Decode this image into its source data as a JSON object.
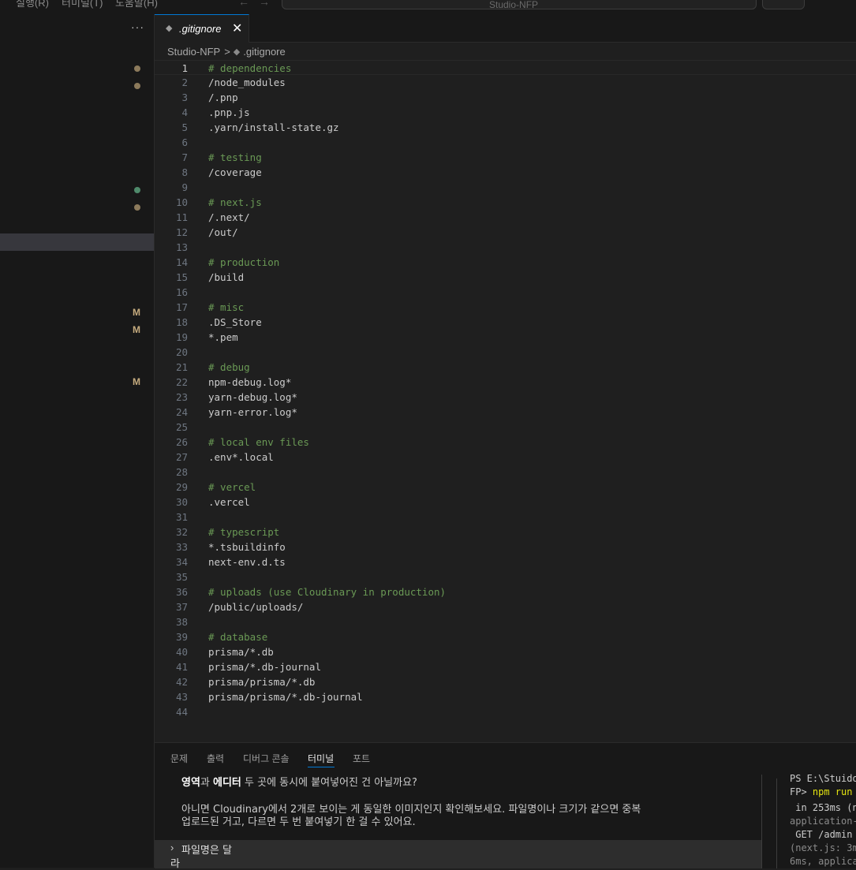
{
  "menubar": {
    "items": [
      "실행(R)",
      "터미널(T)",
      "도움말(H)"
    ],
    "back_arrow": "←",
    "forward_arrow": "→",
    "search_text": "Studio-NFP"
  },
  "sidebar": {
    "more_label": "···",
    "markers": [
      "M",
      "M",
      "M"
    ],
    "dot_colors": [
      "#8c7a5b",
      "#8c7a5b",
      "#4f8a6b",
      "#8c7a5b"
    ]
  },
  "tab": {
    "icon": "◆",
    "label": ".gitignore",
    "close": "✕"
  },
  "breadcrumb": {
    "folder": "Studio-NFP",
    "separator": ">",
    "icon": "◆",
    "file": ".gitignore"
  },
  "editor": {
    "active_line": 1,
    "lines": [
      {
        "n": "1",
        "text": "# dependencies"
      },
      {
        "n": "2",
        "text": "/node_modules"
      },
      {
        "n": "3",
        "text": "/.pnp"
      },
      {
        "n": "4",
        "text": ".pnp.js"
      },
      {
        "n": "5",
        "text": ".yarn/install-state.gz"
      },
      {
        "n": "6",
        "text": ""
      },
      {
        "n": "7",
        "text": "# testing"
      },
      {
        "n": "8",
        "text": "/coverage"
      },
      {
        "n": "9",
        "text": ""
      },
      {
        "n": "10",
        "text": "# next.js"
      },
      {
        "n": "11",
        "text": "/.next/"
      },
      {
        "n": "12",
        "text": "/out/"
      },
      {
        "n": "13",
        "text": ""
      },
      {
        "n": "14",
        "text": "# production"
      },
      {
        "n": "15",
        "text": "/build"
      },
      {
        "n": "16",
        "text": ""
      },
      {
        "n": "17",
        "text": "# misc"
      },
      {
        "n": "18",
        "text": ".DS_Store"
      },
      {
        "n": "19",
        "text": "*.pem"
      },
      {
        "n": "20",
        "text": ""
      },
      {
        "n": "21",
        "text": "# debug"
      },
      {
        "n": "22",
        "text": "npm-debug.log*"
      },
      {
        "n": "23",
        "text": "yarn-debug.log*"
      },
      {
        "n": "24",
        "text": "yarn-error.log*"
      },
      {
        "n": "25",
        "text": ""
      },
      {
        "n": "26",
        "text": "# local env files"
      },
      {
        "n": "27",
        "text": ".env*.local"
      },
      {
        "n": "28",
        "text": ""
      },
      {
        "n": "29",
        "text": "# vercel"
      },
      {
        "n": "30",
        "text": ".vercel"
      },
      {
        "n": "31",
        "text": ""
      },
      {
        "n": "32",
        "text": "# typescript"
      },
      {
        "n": "33",
        "text": "*.tsbuildinfo"
      },
      {
        "n": "34",
        "text": "next-env.d.ts"
      },
      {
        "n": "35",
        "text": ""
      },
      {
        "n": "36",
        "text": "# uploads (use Cloudinary in production)"
      },
      {
        "n": "37",
        "text": "/public/uploads/"
      },
      {
        "n": "38",
        "text": ""
      },
      {
        "n": "39",
        "text": "# database"
      },
      {
        "n": "40",
        "text": "prisma/*.db"
      },
      {
        "n": "41",
        "text": "prisma/*.db-journal"
      },
      {
        "n": "42",
        "text": "prisma/prisma/*.db"
      },
      {
        "n": "43",
        "text": "prisma/prisma/*.db-journal"
      },
      {
        "n": "44",
        "text": ""
      }
    ],
    "comment_color": "#6a9955"
  },
  "panel": {
    "tabs": [
      "문제",
      "출력",
      "디버그 콘솔",
      "터미널",
      "포트"
    ],
    "active_tab": "터미널",
    "chat": {
      "line1_a": "영역",
      "line1_b": "과 ",
      "line1_c": "에디터",
      "line1_d": " 두 곳에 동시에 붙여넣어진 건 아닐까요?",
      "line2": "아니면 Cloudinary에서 2개로 보이는 게 동일한 이미지인지 확인해보세요. 파일명이나 크기가 같으면 중복",
      "line3": "업로드된 거고, 다르면 두 번 붙여넣기 한 걸 수 있어요."
    },
    "input": {
      "arrow": "›",
      "line1": "파일명은 달",
      "line2": "라"
    },
    "terminal": {
      "line1": "PS E:\\Stuido",
      "line2_a": "FP> ",
      "line2_b": "npm run",
      "line3": " in 253ms (n",
      "line4": "application-",
      "line5": " GET /admin ",
      "line6": "(next.js: 3m",
      "line7": "6ms, applica"
    }
  }
}
